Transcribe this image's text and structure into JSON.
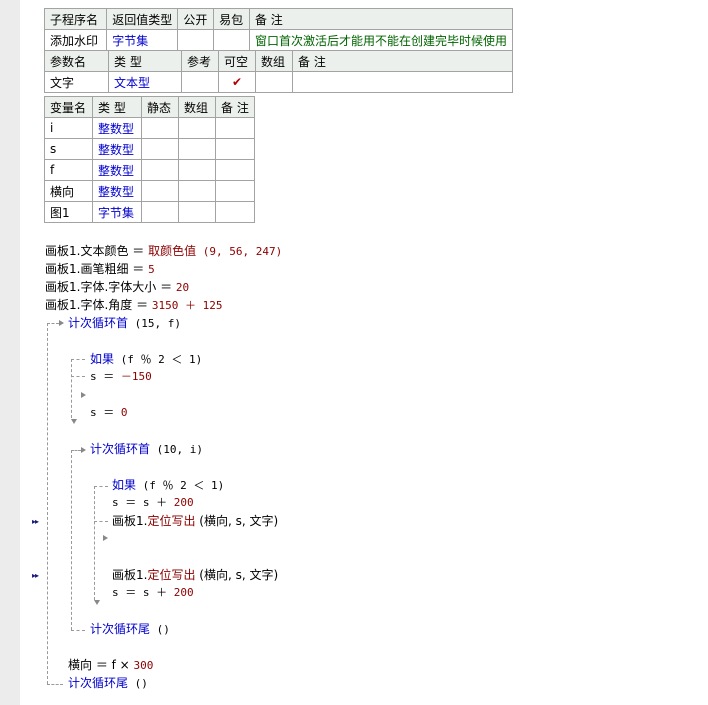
{
  "sub_table": {
    "headers": [
      "子程序名",
      "返回值类型",
      "公开",
      "易包",
      "备 注"
    ],
    "row": {
      "name": "添加水印",
      "return_type": "字节集",
      "public": "",
      "easy_pkg": "",
      "remark": "窗口首次激活后才能用不能在创建完毕时候使用"
    }
  },
  "param_table": {
    "headers": [
      "参数名",
      "类 型",
      "参考",
      "可空",
      "数组",
      "备 注"
    ],
    "rows": [
      {
        "name": "文字",
        "type": "文本型",
        "ref": "",
        "nullable": "✔",
        "array": "",
        "remark": ""
      }
    ]
  },
  "var_table": {
    "headers": [
      "变量名",
      "类 型",
      "静态",
      "数组",
      "备 注"
    ],
    "rows": [
      {
        "name": "i",
        "type": "整数型"
      },
      {
        "name": "s",
        "type": "整数型"
      },
      {
        "name": "f",
        "type": "整数型"
      },
      {
        "name": "横向",
        "type": "整数型"
      },
      {
        "name": "图1",
        "type": "字节集"
      }
    ]
  },
  "code": {
    "l1": {
      "a": "画板1.文本颜色 ＝ ",
      "fn": "取颜色值",
      "b": " (9, 56, 247)"
    },
    "l2": {
      "a": "画板1.画笔粗细 ＝ ",
      "n": "5"
    },
    "l3": {
      "a": "画板1.字体.字体大小 ＝ ",
      "n": "20"
    },
    "l4": {
      "a": "画板1.字体.角度 ＝ ",
      "n": "3150 ＋ 125"
    },
    "loop1": {
      "kw": "计次循环首",
      "args": " (15, f)"
    },
    "if1": {
      "kw": "如果",
      "args": " (f ％ 2 ＜ 1)"
    },
    "s1": {
      "a": "s ＝ ",
      "n": "－150"
    },
    "s2": {
      "a": "s ＝ ",
      "n": "0"
    },
    "loop2": {
      "kw": "计次循环首",
      "args": " (10, i)"
    },
    "if2": {
      "kw": "如果",
      "args": " (f ％ 2 ＜ 1)"
    },
    "s3": {
      "a": "s ＝ s ＋ ",
      "n": "200"
    },
    "draw1": {
      "a": "画板1.",
      "fn": "定位写出",
      "b": " (横向, s, 文字)"
    },
    "draw2": {
      "a": "画板1.",
      "fn": "定位写出",
      "b": " (横向, s, 文字)"
    },
    "s4": {
      "a": "s ＝ s ＋ ",
      "n": "200"
    },
    "loop2_end": {
      "kw": "计次循环尾",
      "args": " ()"
    },
    "h1": {
      "a": "横向 ＝ f × ",
      "n": "300"
    },
    "loop1_end": {
      "kw": "计次循环尾",
      "args": " ()"
    }
  },
  "markers": {
    "breakpoint": "▸▸"
  }
}
